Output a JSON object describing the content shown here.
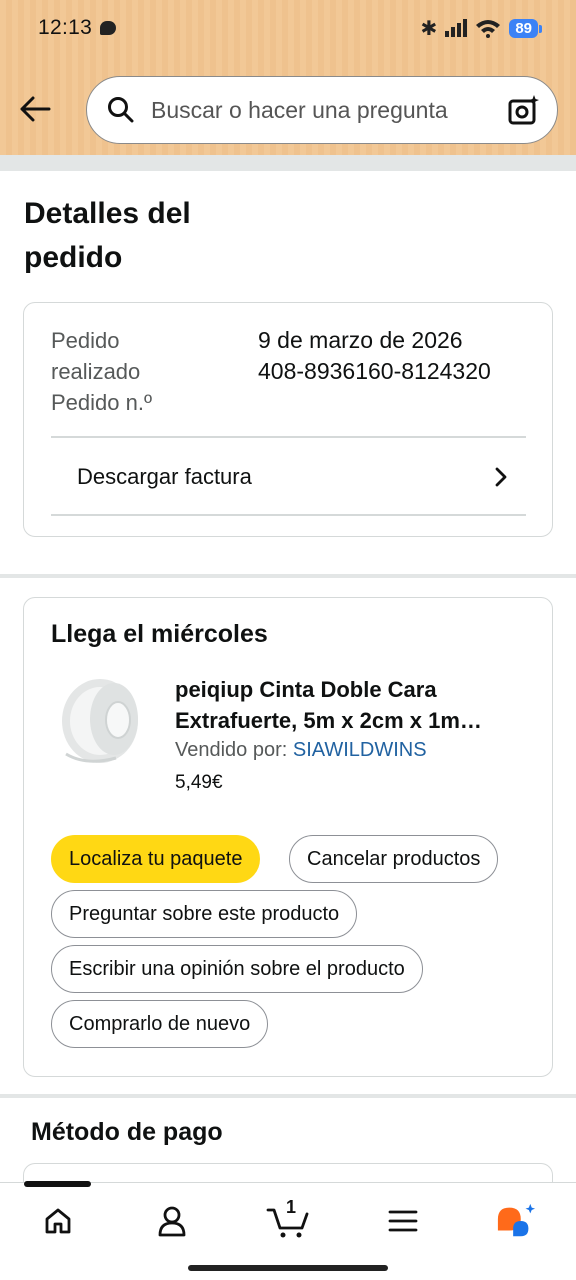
{
  "status_bar": {
    "time": "12:13",
    "battery": "89"
  },
  "header": {
    "search_placeholder": "Buscar o hacer una pregunta"
  },
  "page_title": "Detalles del pedido",
  "order_info": {
    "labels": [
      "Pedido",
      "realizado",
      "Pedido n.º"
    ],
    "date": "9 de marzo de 2026",
    "number": "408-8936160-8124320",
    "invoice_label": "Descargar factura"
  },
  "shipment": {
    "arrival": "Llega el miércoles",
    "product_title_line1": "peiqiup Cinta Doble Cara",
    "product_title_line2": "Extrafuerte, 5m x 2cm x 1m…",
    "seller_label": "Vendido por: ",
    "seller_name": "SIAWILDWINS",
    "price": "5,49€",
    "buttons": {
      "track": "Localiza tu paquete",
      "cancel": "Cancelar productos",
      "ask": "Preguntar sobre este producto",
      "review": "Escribir una opinión sobre el producto",
      "buy_again": "Comprarlo de nuevo"
    }
  },
  "payment": {
    "title": "Método de pago"
  },
  "bottom_nav": {
    "cart_count": "1"
  },
  "colors": {
    "accent_yellow": "#ffd814",
    "link_blue": "#2162a1",
    "header_orange": "#f2c896"
  }
}
